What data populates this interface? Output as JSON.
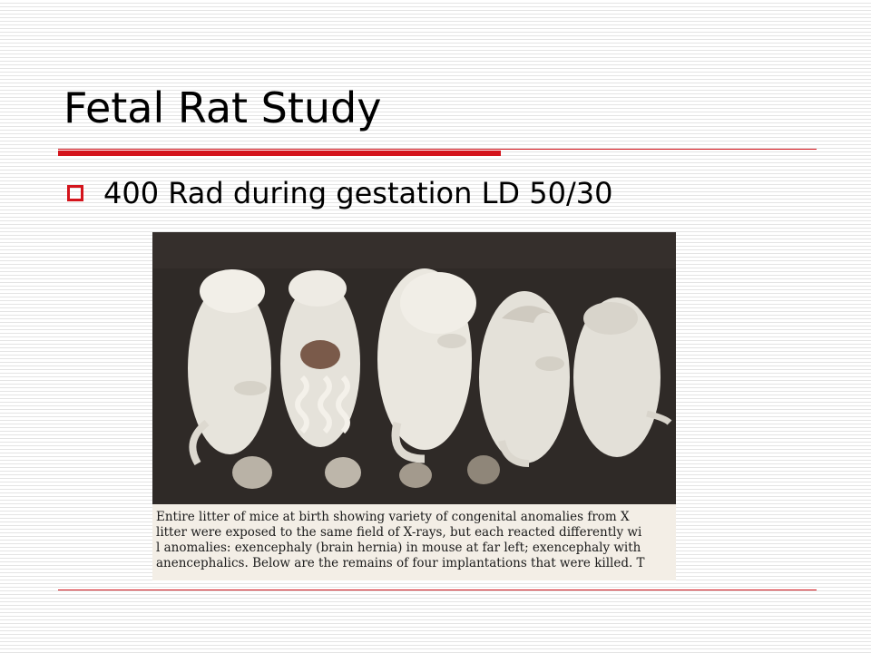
{
  "slide": {
    "title": "Fetal Rat Study",
    "bullet": "400 Rad during gestation LD 50/30"
  },
  "figure": {
    "caption_lines": [
      "Entire litter of mice at birth showing variety of congenital anomalies from X",
      "litter were exposed to the same field of X-rays, but each reacted differently wi",
      "l anomalies: exencephaly (brain hernia) in mouse at far left; exencephaly with",
      "anencephalics. Below are the remains of four implantations that were killed. T"
    ]
  },
  "colors": {
    "accent": "#d4141c",
    "photo_background": "#2f2a27",
    "caption_paper": "#f3eee6"
  },
  "icons": {
    "bullet": "hollow-square-icon"
  }
}
